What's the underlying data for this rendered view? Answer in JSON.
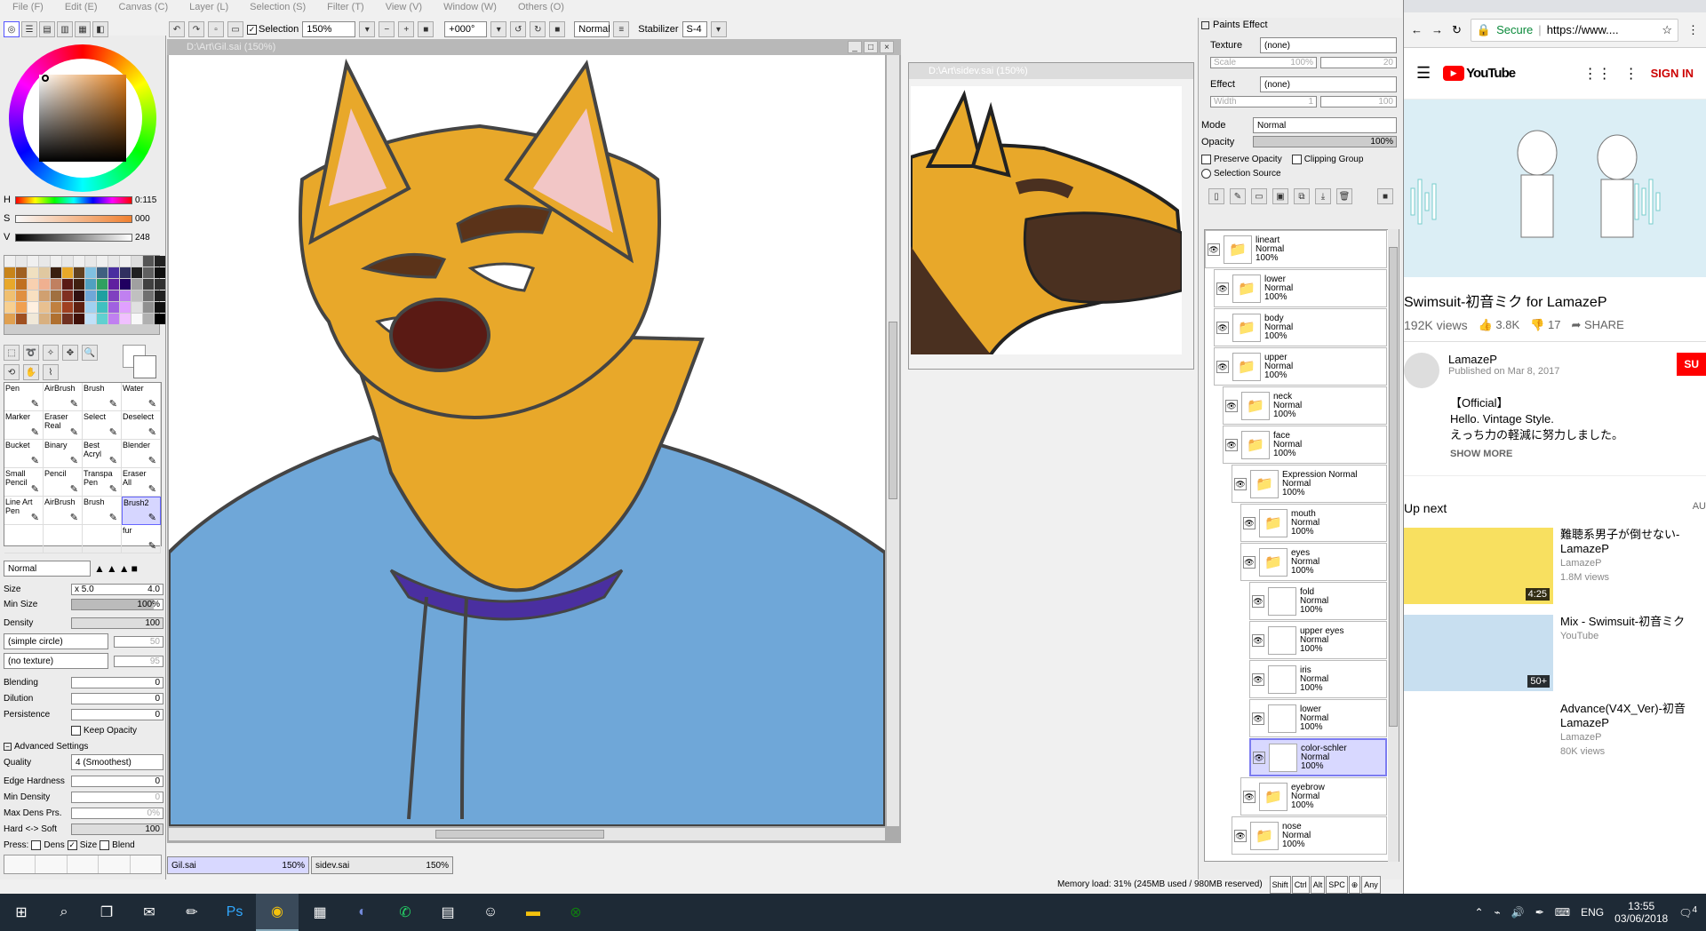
{
  "menu": [
    "File (F)",
    "Edit (E)",
    "Canvas (C)",
    "Layer (L)",
    "Selection (S)",
    "Filter (T)",
    "View (V)",
    "Window (W)",
    "Others (O)"
  ],
  "toolbar": {
    "selection_label": "Selection",
    "zoom": "150%",
    "rotation": "+000°",
    "blend_mode": "Normal",
    "stabilizer_label": "Stabilizer",
    "stabilizer_value": "S-4"
  },
  "color": {
    "h_label": "H",
    "h_value": "0:115",
    "s_label": "S",
    "s_value": "000",
    "v_label": "V",
    "v_value": "248",
    "current": "#e07d1a"
  },
  "tools": [
    {
      "name": "Pen",
      "sub": ""
    },
    {
      "name": "AirBrush",
      "sub": ""
    },
    {
      "name": "Brush",
      "sub": ""
    },
    {
      "name": "Water",
      "sub": ""
    },
    {
      "name": "Marker",
      "sub": ""
    },
    {
      "name": "Eraser",
      "sub": "Real"
    },
    {
      "name": "Select",
      "sub": ""
    },
    {
      "name": "Deselect",
      "sub": ""
    },
    {
      "name": "Bucket",
      "sub": ""
    },
    {
      "name": "Binary",
      "sub": ""
    },
    {
      "name": "Best",
      "sub": "Acryl"
    },
    {
      "name": "Blender",
      "sub": ""
    },
    {
      "name": "Small",
      "sub": "Pencil"
    },
    {
      "name": "Pencil",
      "sub": ""
    },
    {
      "name": "Transpa",
      "sub": "Pen"
    },
    {
      "name": "Eraser",
      "sub": "All"
    },
    {
      "name": "Line Art",
      "sub": "Pen"
    },
    {
      "name": "AirBrush",
      "sub": ""
    },
    {
      "name": "Brush",
      "sub": ""
    },
    {
      "name": "Brush2",
      "sub": ""
    },
    {
      "name": "",
      "sub": ""
    },
    {
      "name": "",
      "sub": ""
    },
    {
      "name": "",
      "sub": ""
    },
    {
      "name": "fur",
      "sub": ""
    }
  ],
  "brush": {
    "mode": "Normal",
    "size_label": "Size",
    "size_mult": "x 5.0",
    "size_value": "4.0",
    "min_size_label": "Min Size",
    "min_size_value": "100%",
    "density_label": "Density",
    "density_value": "100",
    "shape": "(simple circle)",
    "shape_value": "50",
    "texture": "(no texture)",
    "texture_value": "95",
    "blending_label": "Blending",
    "blending_value": "0",
    "dilution_label": "Dilution",
    "dilution_value": "0",
    "persistence_label": "Persistence",
    "persistence_value": "0",
    "keep_opacity": "Keep Opacity",
    "advanced_label": "Advanced Settings",
    "quality_label": "Quality",
    "quality_value": "4 (Smoothest)",
    "edge_label": "Edge Hardness",
    "edge_value": "0",
    "min_density_label": "Min Density",
    "min_density_value": "0",
    "max_dens_label": "Max Dens Prs.",
    "max_dens_value": "0%",
    "hardsoft_label": "Hard <-> Soft",
    "hardsoft_value": "100",
    "press_label": "Press:",
    "press_dens": "Dens",
    "press_size": "Size",
    "press_blend": "Blend"
  },
  "canvas": {
    "title": "D:\\Art\\Gil.sai (150%)",
    "sub_title": "D:\\Art\\sidev.sai (150%)"
  },
  "file_tabs": [
    {
      "name": "Gil.sai",
      "zoom": "150%"
    },
    {
      "name": "sidev.sai",
      "zoom": "150%"
    }
  ],
  "paints_effect": {
    "title": "Paints Effect",
    "texture_label": "Texture",
    "texture_value": "(none)",
    "scale_label": "Scale",
    "scale_value": "100%",
    "scale_num": "20",
    "effect_label": "Effect",
    "effect_value": "(none)",
    "width_label": "Width",
    "width_value": "1",
    "width_num": "100",
    "mode_label": "Mode",
    "mode_value": "Normal",
    "opacity_label": "Opacity",
    "opacity_value": "100%",
    "preserve_opacity": "Preserve Opacity",
    "clipping_group": "Clipping Group",
    "selection_source": "Selection Source"
  },
  "layers": [
    {
      "name": "lineart",
      "mode": "Normal",
      "opacity": "100%",
      "folder": true,
      "indent": 0
    },
    {
      "name": "lower",
      "mode": "Normal",
      "opacity": "100%",
      "folder": true,
      "indent": 1
    },
    {
      "name": "body",
      "mode": "Normal",
      "opacity": "100%",
      "folder": true,
      "indent": 1
    },
    {
      "name": "upper",
      "mode": "Normal",
      "opacity": "100%",
      "folder": true,
      "indent": 1
    },
    {
      "name": "neck",
      "mode": "Normal",
      "opacity": "100%",
      "folder": true,
      "indent": 2
    },
    {
      "name": "face",
      "mode": "Normal",
      "opacity": "100%",
      "folder": true,
      "indent": 2
    },
    {
      "name": "Expression Normal",
      "mode": "Normal",
      "opacity": "100%",
      "folder": true,
      "indent": 3
    },
    {
      "name": "mouth",
      "mode": "Normal",
      "opacity": "100%",
      "folder": true,
      "indent": 4
    },
    {
      "name": "eyes",
      "mode": "Normal",
      "opacity": "100%",
      "folder": true,
      "indent": 4
    },
    {
      "name": "fold",
      "mode": "Normal",
      "opacity": "100%",
      "folder": false,
      "indent": 5
    },
    {
      "name": "upper eyes",
      "mode": "Normal",
      "opacity": "100%",
      "folder": false,
      "indent": 5
    },
    {
      "name": "iris",
      "mode": "Normal",
      "opacity": "100%",
      "folder": false,
      "indent": 5
    },
    {
      "name": "lower",
      "mode": "Normal",
      "opacity": "100%",
      "folder": false,
      "indent": 5
    },
    {
      "name": "color-schler",
      "mode": "Normal",
      "opacity": "100%",
      "folder": false,
      "indent": 5,
      "selected": true
    },
    {
      "name": "eyebrow",
      "mode": "Normal",
      "opacity": "100%",
      "folder": true,
      "indent": 4
    },
    {
      "name": "nose",
      "mode": "Normal",
      "opacity": "100%",
      "folder": true,
      "indent": 3
    }
  ],
  "status": {
    "memory": "Memory load: 31% (245MB used / 980MB reserved)",
    "keys": [
      "Shift",
      "Ctrl",
      "Alt",
      "SPC",
      "⊕",
      "Any"
    ]
  },
  "browser": {
    "secure": "Secure",
    "url": "https://www....",
    "sign_in": "SIGN IN",
    "youtube_logo": "YouTube",
    "video_title": "Swimsuit-初音ミク for LamazeP",
    "views": "192K views",
    "likes": "3.8K",
    "dislikes": "17",
    "share": "SHARE",
    "channel": "LamazeP",
    "published": "Published on Mar 8, 2017",
    "subscribe": "SU",
    "desc": [
      "【Official】",
      "Hello. Vintage Style.",
      "えっち力の軽減に努力しました。"
    ],
    "show_more": "SHOW MORE",
    "up_next": "Up next",
    "autoplay": "AU",
    "videos": [
      {
        "title": "難聴系男子が倒せない-",
        "channel2": "LamazeP",
        "channel": "LamazeP",
        "views": "1.8M views",
        "duration": "4:25"
      },
      {
        "title": "Mix - Swimsuit-初音ミク",
        "channel2": "",
        "channel": "YouTube",
        "views": "",
        "duration": "50+"
      },
      {
        "title": "Advance(V4X_Ver)-初音",
        "channel2": "LamazeP",
        "channel": "LamazeP",
        "views": "80K views",
        "duration": ""
      }
    ]
  },
  "taskbar": {
    "lang": "ENG",
    "time": "13:55",
    "date": "03/06/2018",
    "notifications": "4"
  }
}
